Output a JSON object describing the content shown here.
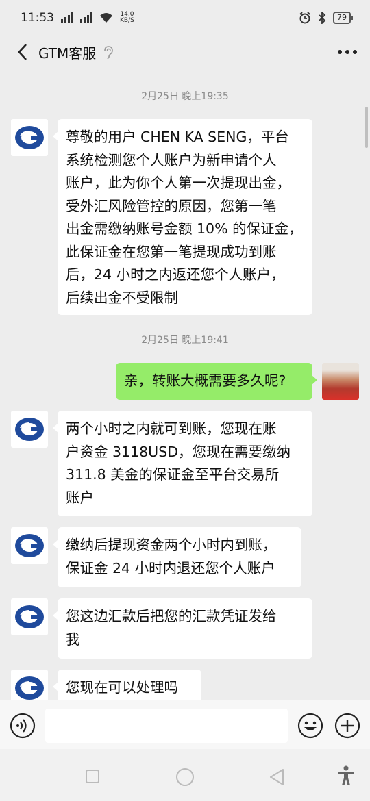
{
  "status_bar": {
    "time": "11:53",
    "net_speed_value": "14.0",
    "net_speed_unit": "KB/S",
    "battery": "79"
  },
  "header": {
    "title": "GTM客服"
  },
  "messages": {
    "time_1": "2月25日 晚上19:35",
    "msg_1": "尊敬的用户 CHEN KA SENG，平台\n系统检测您个人账户为新申请个人\n账户，此为你个人第一次提现出金，\n受外汇风险管控的原因，您第一笔\n出金需缴纳账号金额 10% 的保证金，\n此保证金在您第一笔提现成功到账\n后，24 小时之内返还您个人账户，\n后续出金不受限制",
    "time_2": "2月25日 晚上19:41",
    "msg_2": "亲，转账大概需要多久呢?",
    "msg_3": "两个小时之内就可到账，您现在账\n户资金 3118USD，您现在需要缴纳\n311.8 美金的保证金至平台交易所\n账户",
    "msg_4": "缴纳后提现资金两个小时内到账，\n保证金 24 小时内退还您个人账户",
    "msg_5": "您这边汇款后把您的汇款凭证发给\n我",
    "msg_6": "您现在可以处理吗"
  },
  "input": {
    "value": ""
  },
  "colors": {
    "chat_bg": "#ededed",
    "my_bubble": "#95ec69",
    "their_bubble": "#ffffff",
    "logo_blue": "#1f4a9c"
  },
  "icons": [
    "back-arrow-icon",
    "ear-icon",
    "more-icon",
    "gtm-logo-icon",
    "voice-icon",
    "emoji-icon",
    "plus-icon",
    "nav-recent-icon",
    "nav-home-icon",
    "nav-back-icon",
    "accessibility-icon"
  ]
}
